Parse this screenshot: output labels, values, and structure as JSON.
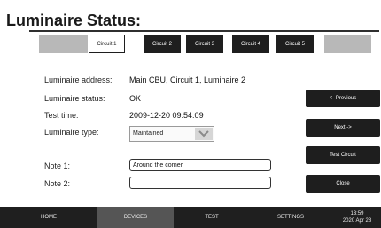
{
  "title": "Luminaire Status:",
  "tabs": [
    "Circuit 1",
    "Circuit 2",
    "Circuit 3",
    "Circuit 4",
    "Circuit 5"
  ],
  "active_tab": "Circuit 1",
  "details": {
    "address_label": "Luminaire address:",
    "address_value": "Main CBU, Circuit 1, Luminaire 2",
    "status_label": "Luminaire status:",
    "status_value": "OK",
    "test_time_label": "Test time:",
    "test_time_value": "2009-12-20 09:54:09",
    "type_label": "Luminaire type:",
    "type_value": "Maintained"
  },
  "notes": {
    "note1_label": "Note 1:",
    "note1_value": "Around the corner",
    "note2_label": "Note 2:",
    "note2_value": ""
  },
  "buttons": {
    "previous": "<- Previous",
    "next": "Next ->",
    "test_circuit": "Test Circuit",
    "close": "Close"
  },
  "nav": {
    "home": "HOME",
    "devices": "DEVICES",
    "test": "TEST",
    "settings": "SETTINGS",
    "time": "13:59",
    "date": "2020 Apr 28"
  },
  "icons": {
    "dropdown": "chevron-down-icon"
  },
  "colors": {
    "dark": "#1e1e1e",
    "nav_active": "#555555",
    "gray_tab": "#b8b8b8"
  }
}
